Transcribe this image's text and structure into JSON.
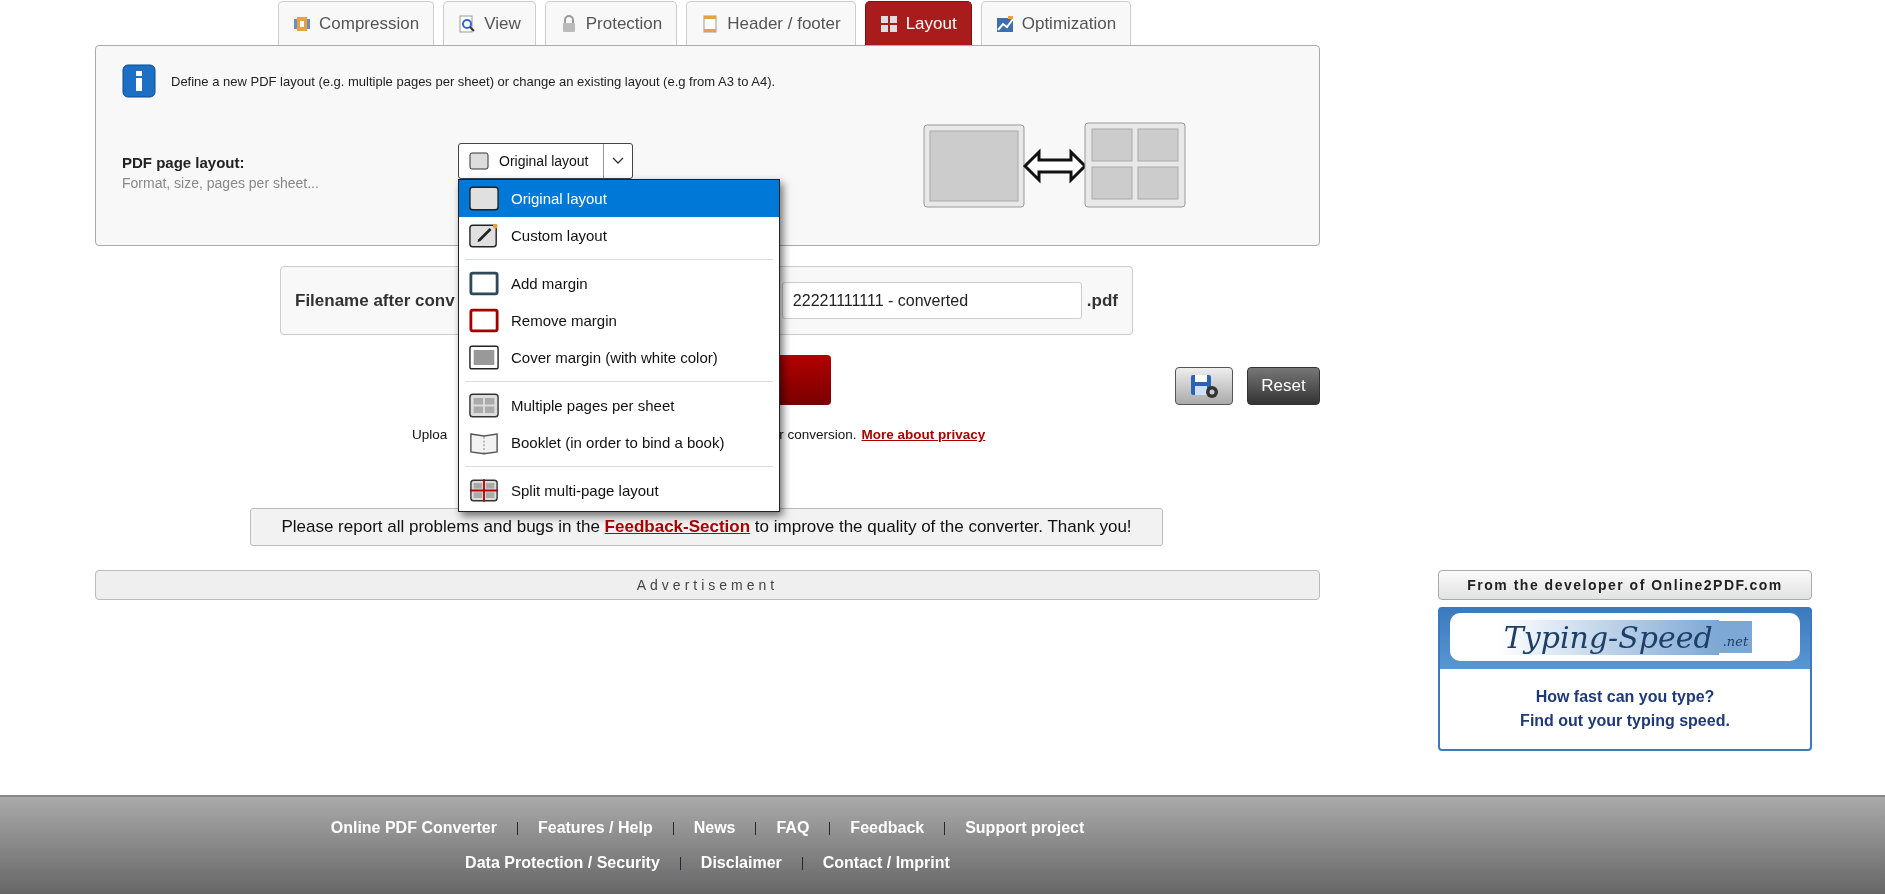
{
  "tabs": [
    {
      "label": "Compression",
      "kind": "compression",
      "selected": false
    },
    {
      "label": "View",
      "kind": "view",
      "selected": false
    },
    {
      "label": "Protection",
      "kind": "protection",
      "selected": false
    },
    {
      "label": "Header / footer",
      "kind": "header",
      "selected": false
    },
    {
      "label": "Layout",
      "kind": "layout",
      "selected": true
    },
    {
      "label": "Optimization",
      "kind": "optimization",
      "selected": false
    }
  ],
  "info": {
    "text": "Define a new PDF layout (e.g. multiple pages per sheet) or change an existing layout (e.g from A3 to A4)."
  },
  "layout_field": {
    "label": "PDF page layout:",
    "hint": "Format, size, pages per sheet...",
    "value": "Original layout",
    "expanded": true
  },
  "dropdown": {
    "groups": [
      [
        {
          "label": "Original layout",
          "kind": "plain",
          "selected": true
        },
        {
          "label": "Custom layout",
          "kind": "pencil",
          "selected": false
        }
      ],
      [
        {
          "label": "Add margin",
          "kind": "frame",
          "selected": false
        },
        {
          "label": "Remove margin",
          "kind": "redframe",
          "selected": false
        },
        {
          "label": "Cover margin (with white color)",
          "kind": "fill",
          "selected": false
        }
      ],
      [
        {
          "label": "Multiple pages per sheet",
          "kind": "grid",
          "selected": false
        },
        {
          "label": "Booklet (in order to bind a book)",
          "kind": "book",
          "selected": false
        }
      ],
      [
        {
          "label": "Split multi-page layout",
          "kind": "split",
          "selected": false
        }
      ]
    ]
  },
  "filename": {
    "label": "Filename after conv",
    "value": "22221111111 - converted",
    "extension": ".pdf"
  },
  "reset": "Reset",
  "upload_note": {
    "start": "Uploa",
    "end": "r conversion.",
    "link": "More about privacy"
  },
  "feedback": {
    "before": "Please report all problems and bugs in the",
    "link": "Feedback-Section",
    "after": "to improve the quality of the converter. Thank you!"
  },
  "advertisement": "Advertisement",
  "promo": {
    "header": "From the developer of Online2PDF.com",
    "logo": "Typing-Speed",
    "logo_suffix": ".net",
    "lines": [
      "How fast can you type?",
      "Find out your typing speed."
    ]
  },
  "footer": {
    "lines": [
      {
        "links": [
          "Online PDF Converter",
          "Features / Help",
          "News",
          "FAQ",
          "Feedback",
          "Support project"
        ]
      },
      {
        "links": [
          "Data Protection / Security",
          "Disclaimer",
          "Contact / Imprint"
        ]
      }
    ]
  }
}
